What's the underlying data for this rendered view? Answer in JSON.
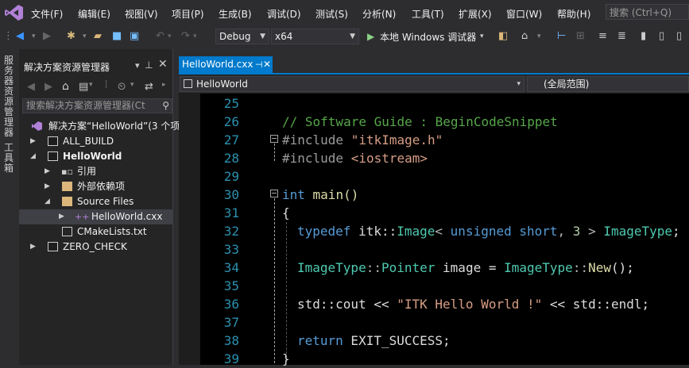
{
  "menubar": {
    "items": [
      "文件(F)",
      "编辑(E)",
      "视图(V)",
      "项目(P)",
      "生成(B)",
      "调试(D)",
      "测试(S)",
      "分析(N)",
      "工具(T)",
      "扩展(X)",
      "窗口(W)",
      "帮助(H)"
    ],
    "search_placeholder": "搜索 (Ctrl+Q)"
  },
  "toolbar": {
    "config": "Debug",
    "platform": "x64",
    "run_label": "本地 Windows 调试器"
  },
  "sidestrip": {
    "server_explorer": "服务器资源管理器",
    "toolbox": "工具箱"
  },
  "solution_explorer": {
    "title": "解决方案资源管理器",
    "search_placeholder": "搜索解决方案资源管理器(Ct",
    "items": [
      {
        "label": "解决方案“HelloWorld”(3 个项目"
      },
      {
        "label": "ALL_BUILD"
      },
      {
        "label": "HelloWorld"
      },
      {
        "label": "引用"
      },
      {
        "label": "外部依赖项"
      },
      {
        "label": "Source Files"
      },
      {
        "label": "HelloWorld.cxx"
      },
      {
        "label": "CMakeLists.txt"
      },
      {
        "label": "ZERO_CHECK"
      }
    ]
  },
  "editor": {
    "tab_label": "HelloWorld.cxx",
    "scope_combo": "HelloWorld",
    "member_combo": "(全局范围)",
    "line_numbers": [
      "25",
      "26",
      "27",
      "28",
      "29",
      "30",
      "31",
      "32",
      "33",
      "34",
      "35",
      "36",
      "37",
      "38",
      "39"
    ],
    "code": {
      "l26": "// Software Guide : BeginCodeSnippet",
      "l27_dir": "#include",
      "l27_file": "\"itkImage.h\"",
      "l28_dir": "#include",
      "l28_file": "<iostream>",
      "l30_kw": "int",
      "l30_rest": " main()",
      "l31": "{",
      "l32_kw": "typedef",
      "l32_a": " itk::",
      "l32_ty": "Image",
      "l32_b": "< ",
      "l32_kw2": "unsigned short",
      "l32_c": ", ",
      "l32_num": "3",
      "l32_d": " > ",
      "l32_ty2": "ImageType",
      "l32_e": ";",
      "l34_ty": "ImageType",
      "l34_a": "::",
      "l34_ty2": "Pointer",
      "l34_b": " image = ",
      "l34_ty3": "ImageType",
      "l34_c": "::",
      "l34_fn": "New",
      "l34_d": "();",
      "l36_a": "std::cout << ",
      "l36_str": "\"ITK Hello World !\"",
      "l36_b": " << std::endl;",
      "l38_kw": "return",
      "l38_rest": " EXIT_SUCCESS;",
      "l39": "}"
    }
  },
  "colors": {
    "accent": "#007acc",
    "comment": "#57a64a",
    "keyword": "#569cd6",
    "type": "#4ec9b0",
    "string": "#d69d85",
    "line_number": "#2b91af"
  }
}
